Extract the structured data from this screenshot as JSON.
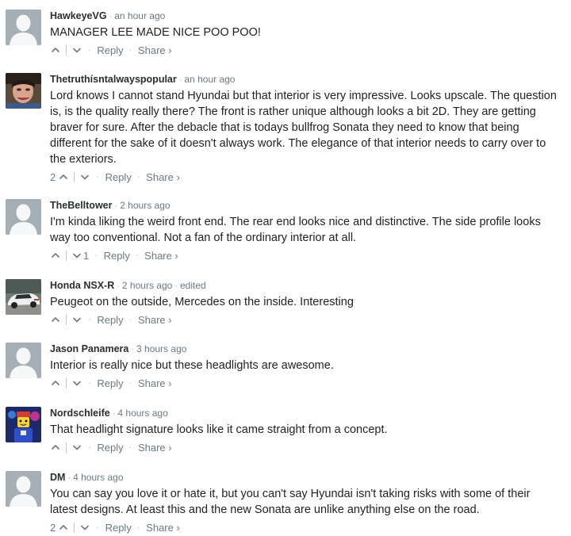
{
  "comments": [
    {
      "author": "HawkeyeVG",
      "time": "an hour ago",
      "edited": "",
      "text": "MANAGER LEE MADE NICE POO POO!",
      "upvotes": "",
      "downvotes": "",
      "avatar": "default"
    },
    {
      "author": "Thetruthísntalwayspopular",
      "time": "an hour ago",
      "edited": "",
      "text": "Lord knows I cannot stand Hyundai but that interior is very impressive. Looks upscale. The question is, is the quality really there? The front is rather unique although looks a bit 2D. They are getting braver for sure. After the debacle that is todays bullfrog Sonata they need to know that being different for the sake of it doesn't always work. The elegance of that interior needs to carry over to the exteriors.",
      "upvotes": "2",
      "downvotes": "",
      "avatar": "photo-face"
    },
    {
      "author": "TheBelltower",
      "time": "2 hours ago",
      "edited": "",
      "text": "I'm kinda liking the weird front end. The rear end looks nice and distinctive. The side profile looks way too conventional. Not a fan of the ordinary interior at all.",
      "upvotes": "",
      "downvotes": "1",
      "avatar": "default"
    },
    {
      "author": "Honda NSX-R",
      "time": "2 hours ago",
      "edited": "edited",
      "text": "Peugeot on the outside, Mercedes on the inside. Interesting",
      "upvotes": "",
      "downvotes": "",
      "avatar": "photo-car"
    },
    {
      "author": "Jason Panamera",
      "time": "3 hours ago",
      "edited": "",
      "text": "Interior is really nice but these headlights are awesome.",
      "upvotes": "",
      "downvotes": "",
      "avatar": "default"
    },
    {
      "author": "Nordschleife",
      "time": "4 hours ago",
      "edited": "",
      "text": "That headlight signature looks like it came straight from a concept.",
      "upvotes": "",
      "downvotes": "",
      "avatar": "photo-lego"
    },
    {
      "author": "DM",
      "time": "4 hours ago",
      "edited": "",
      "text": "You can say you love it or hate it, but you can't say Hyundai isn't taking risks with some of their latest designs. At least this and the new Sonata are unlike anything else on the road.",
      "upvotes": "2",
      "downvotes": "",
      "avatar": "default"
    }
  ],
  "labels": {
    "reply": "Reply",
    "share": "Share ›",
    "separator": "·"
  },
  "colors": {
    "meta": "#687a86",
    "text": "#222222",
    "avatar_bg": "#a6aeb6"
  }
}
